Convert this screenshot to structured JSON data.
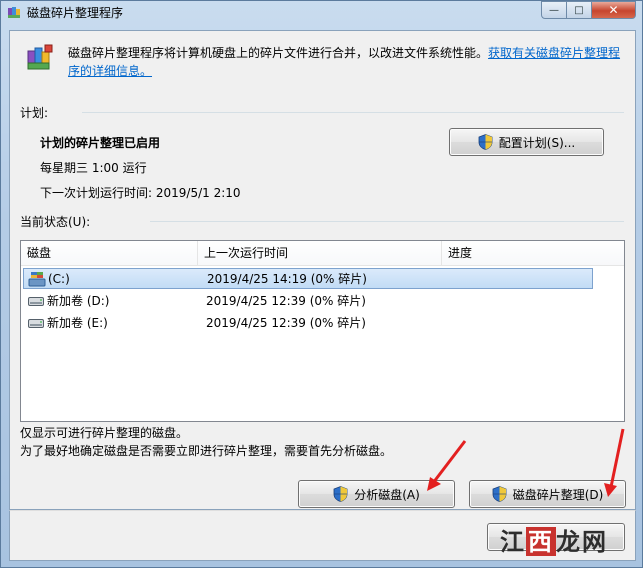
{
  "window": {
    "title": "磁盘碎片整理程序",
    "controls": {
      "minimize": "—",
      "maximize": "□",
      "close": "✕"
    }
  },
  "intro": {
    "text": "磁盘碎片整理程序将计算机硬盘上的碎片文件进行合并，以改进文件系统性能。",
    "link": "获取有关磁盘碎片整理程序的详细信息。"
  },
  "schedule": {
    "label": "计划:",
    "status": "计划的碎片整理已启用",
    "frequency": "每星期三  1:00 运行",
    "next_run": "下一次计划运行时间: 2019/5/1 2:10",
    "configure_button": "配置计划(S)..."
  },
  "current_status": {
    "label": "当前状态(U):",
    "columns": [
      "磁盘",
      "上一次运行时间",
      "进度"
    ],
    "rows": [
      {
        "disk": "(C:)",
        "last_run": "2019/4/25 14:19 (0% 碎片)",
        "progress": "",
        "selected": true,
        "icon": "system-drive-icon"
      },
      {
        "disk": "新加卷 (D:)",
        "last_run": "2019/4/25 12:39 (0% 碎片)",
        "progress": "",
        "selected": false,
        "icon": "drive-icon"
      },
      {
        "disk": "新加卷 (E:)",
        "last_run": "2019/4/25 12:39 (0% 碎片)",
        "progress": "",
        "selected": false,
        "icon": "drive-icon"
      }
    ]
  },
  "notes": {
    "line1": "仅显示可进行碎片整理的磁盘。",
    "line2": "为了最好地确定磁盘是否需要立即进行碎片整理，需要首先分析磁盘。"
  },
  "actions": {
    "analyze_button": "分析磁盘(A)",
    "defrag_button": "磁盘碎片整理(D)"
  },
  "watermark": {
    "left": "江",
    "mid": "西",
    "right": "龙网"
  },
  "colors": {
    "accent_link": "#0066cc",
    "arrow": "#e32020",
    "selection": "#c2dcf5"
  }
}
